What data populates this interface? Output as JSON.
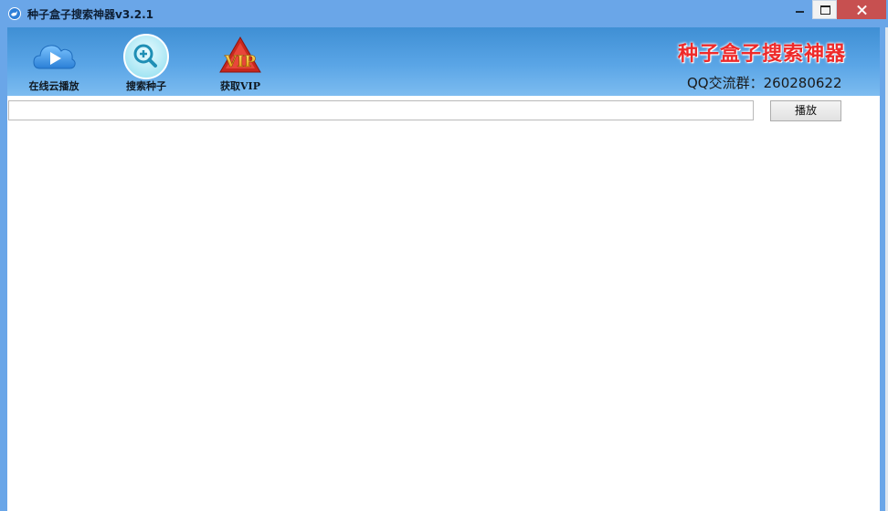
{
  "window": {
    "title": "种子盒子搜索神器v3.2.1"
  },
  "toolbar": {
    "items": [
      {
        "label": "在线云播放",
        "icon": "cloud-play-icon"
      },
      {
        "label": "搜索种子",
        "icon": "magnifier-plus-icon"
      },
      {
        "label": "获取VIP",
        "icon": "vip-badge-icon"
      }
    ],
    "brand_title": "种子盒子搜索神器",
    "qq_group": "QQ交流群：260280622"
  },
  "player": {
    "url_value": "",
    "play_label": "播放"
  },
  "colors": {
    "titlebar": "#6aa6e8",
    "toolbar": "#4b9ae0",
    "close_button": "#c75050",
    "brand_red": "#ee2a2a"
  }
}
